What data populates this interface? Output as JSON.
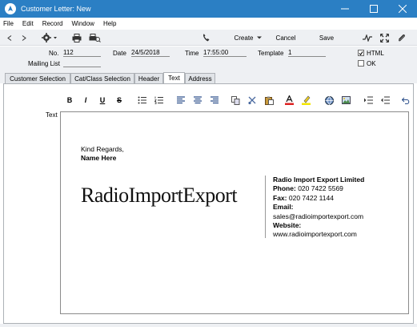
{
  "window": {
    "title": "Customer Letter: New"
  },
  "menu": [
    "File",
    "Edit",
    "Record",
    "Window",
    "Help"
  ],
  "toolbar": {
    "create_label": "Create",
    "cancel_label": "Cancel",
    "save_label": "Save"
  },
  "fields": {
    "no_label": "No.",
    "no_value": "112",
    "date_label": "Date",
    "date_value": "24/5/2018",
    "time_label": "Time",
    "time_value": "17:55:00",
    "template_label": "Template",
    "template_value": "1",
    "mailing_list_label": "Mailing List",
    "mailing_list_value": "",
    "html_label": "HTML",
    "html_checked": true,
    "ok_label": "OK",
    "ok_checked": false
  },
  "tabs": [
    "Customer Selection",
    "Cat/Class Selection",
    "Header",
    "Text",
    "Address"
  ],
  "active_tab": "Text",
  "editor": {
    "field_label": "Text",
    "regards_line": "Kind Regards,",
    "name_line": "Name Here",
    "logo_text": "RadioImportExport",
    "company_name": "Radio Import Export Limited",
    "phone_label": "Phone:",
    "phone_value": "020 7422 5569",
    "fax_label": "Fax:",
    "fax_value": "020 7422 1144",
    "email_label": "Email:",
    "email_value": "sales@radioimportexport.com",
    "website_label": "Website:",
    "website_value": "www.radioimportexport.com"
  },
  "format_toolbar": {
    "bold": "B",
    "italic": "I",
    "underline": "U",
    "strike": "S"
  },
  "colors": {
    "titlebar": "#2b7fc4",
    "toolbar_bg": "#eef0f3",
    "active_tab": "#ffffff"
  }
}
